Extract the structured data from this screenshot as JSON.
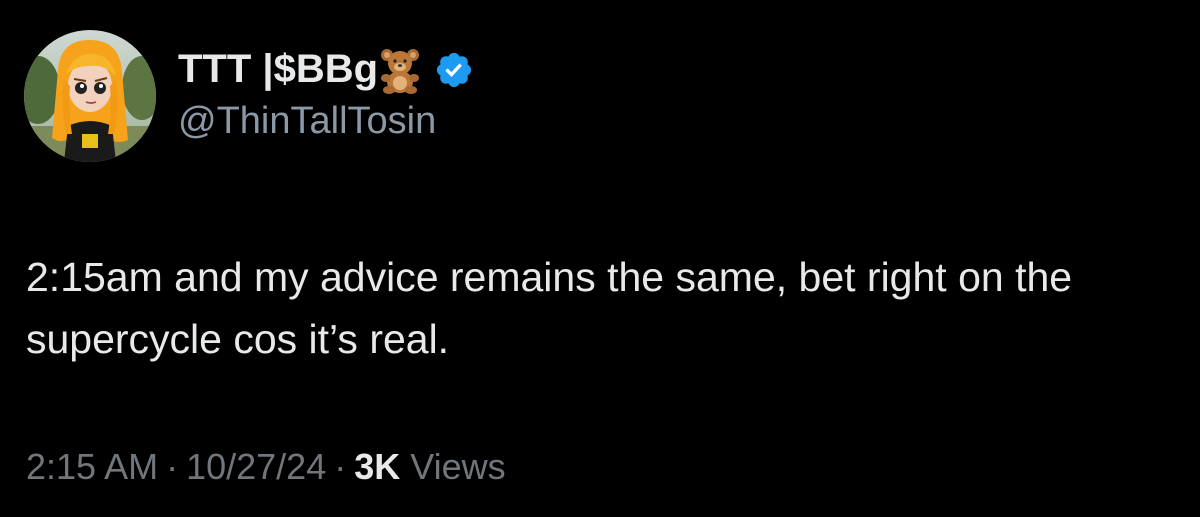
{
  "author": {
    "display_name": "TTT |$BBg",
    "emoji": "teddy-bear",
    "handle": "@ThinTallTosin",
    "verified": true,
    "verified_color": "#1d9bf0"
  },
  "tweet": {
    "text": "2:15am and my advice remains the same, bet right on the supercycle cos it’s real."
  },
  "meta": {
    "time": "2:15 AM",
    "separator": "·",
    "date": "10/27/24",
    "views_count": "3K",
    "views_label": "Views"
  },
  "colors": {
    "background": "#000000",
    "primary_text": "#e7e9ea",
    "secondary_text": "#71767b"
  }
}
